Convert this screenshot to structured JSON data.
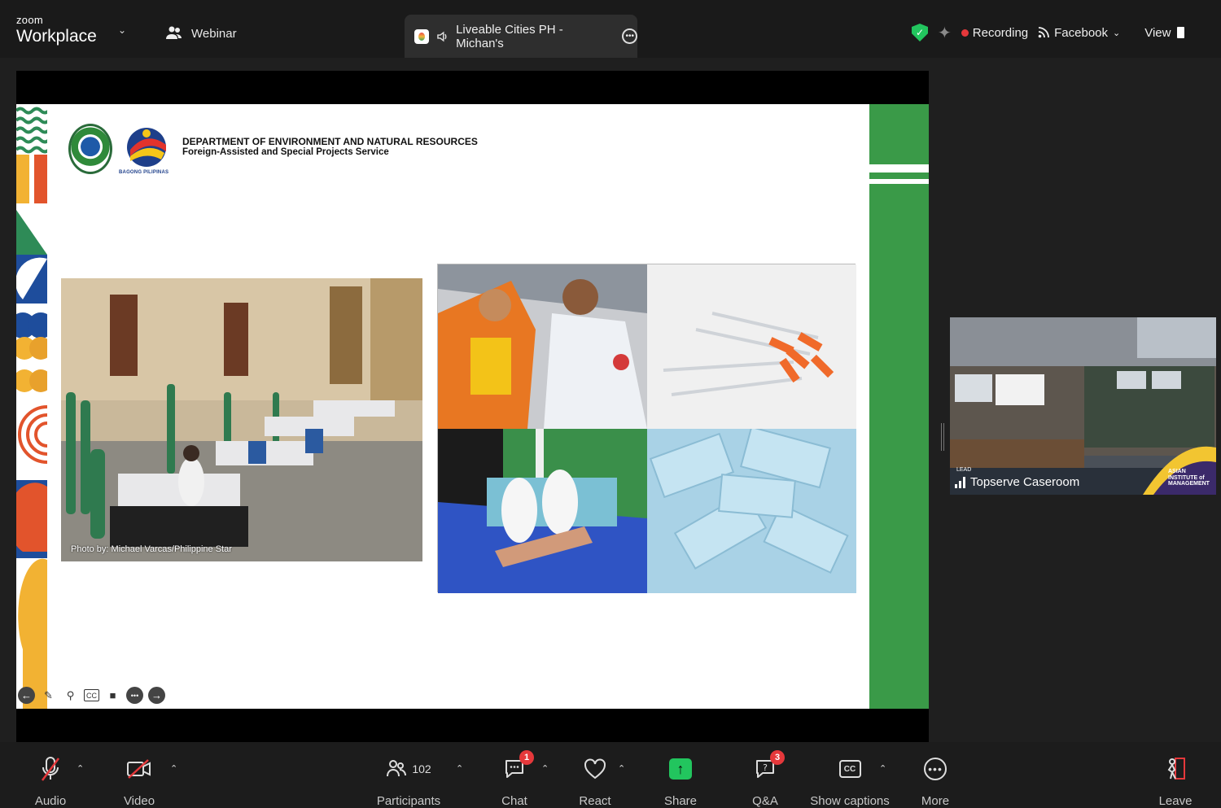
{
  "app": {
    "brand_small": "zoom",
    "brand_big": "Workplace"
  },
  "topbar": {
    "webinar_label": "Webinar",
    "tab_title": "Liveable Cities PH - Michan's",
    "recording_label": "Recording",
    "facebook_label": "Facebook",
    "view_label": "View"
  },
  "slide": {
    "dept_line1": "DEPARTMENT OF ENVIRONMENT AND NATURAL RESOURCES",
    "dept_line2": "Foreign-Assisted and Special Projects Service",
    "logo_caption": "BAGONG PILIPINAS",
    "photo_caption": "Photo by: Michael Varcas/Philippine Star"
  },
  "thumbnail": {
    "name": "Topserve Caseroom",
    "lead": "LEAD",
    "logo_text": "ASIAN INSTITUTE of MANAGEMENT"
  },
  "toolbar": {
    "audio": "Audio",
    "video": "Video",
    "participants": "Participants",
    "participants_count": "102",
    "chat": "Chat",
    "chat_badge": "1",
    "react": "React",
    "share": "Share",
    "qa": "Q&A",
    "qa_badge": "3",
    "captions": "Show captions",
    "captions_icon": "CC",
    "more": "More",
    "leave": "Leave"
  },
  "colors": {
    "accent_green": "#22c55e",
    "slide_green": "#3a9a48",
    "record_red": "#e5383b"
  }
}
